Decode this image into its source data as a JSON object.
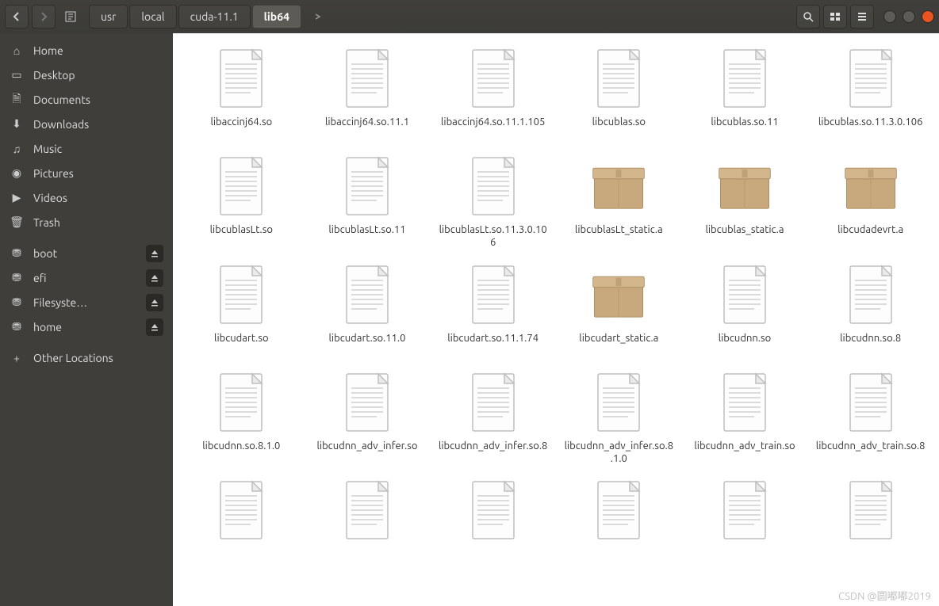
{
  "breadcrumb": [
    "usr",
    "local",
    "cuda-11.1",
    "lib64"
  ],
  "breadcrumb_active_index": 3,
  "sidebar": {
    "places": [
      {
        "icon": "home",
        "label": "Home"
      },
      {
        "icon": "desktop",
        "label": "Desktop"
      },
      {
        "icon": "document",
        "label": "Documents"
      },
      {
        "icon": "download",
        "label": "Downloads"
      },
      {
        "icon": "music",
        "label": "Music"
      },
      {
        "icon": "pictures",
        "label": "Pictures"
      },
      {
        "icon": "videos",
        "label": "Videos"
      },
      {
        "icon": "trash",
        "label": "Trash"
      }
    ],
    "mounts": [
      {
        "icon": "disk",
        "label": "boot",
        "eject": true
      },
      {
        "icon": "disk",
        "label": "efi",
        "eject": true
      },
      {
        "icon": "disk",
        "label": "Filesyste…",
        "eject": true
      },
      {
        "icon": "disk",
        "label": "home",
        "eject": true
      }
    ],
    "other": {
      "icon": "plus",
      "label": "Other Locations"
    }
  },
  "files": [
    {
      "name": "libaccinj64.so",
      "type": "text"
    },
    {
      "name": "libaccinj64.so.11.1",
      "type": "text"
    },
    {
      "name": "libaccinj64.so.11.1.105",
      "type": "text"
    },
    {
      "name": "libcublas.so",
      "type": "text"
    },
    {
      "name": "libcublas.so.11",
      "type": "text"
    },
    {
      "name": "libcublas.so.11.3.0.106",
      "type": "text"
    },
    {
      "name": "libcublasLt.so",
      "type": "text"
    },
    {
      "name": "libcublasLt.so.11",
      "type": "text"
    },
    {
      "name": "libcublasLt.so.11.3.0.106",
      "type": "text"
    },
    {
      "name": "libcublasLt_static.a",
      "type": "archive"
    },
    {
      "name": "libcublas_static.a",
      "type": "archive"
    },
    {
      "name": "libcudadevrt.a",
      "type": "archive"
    },
    {
      "name": "libcudart.so",
      "type": "text"
    },
    {
      "name": "libcudart.so.11.0",
      "type": "text"
    },
    {
      "name": "libcudart.so.11.1.74",
      "type": "text"
    },
    {
      "name": "libcudart_static.a",
      "type": "archive"
    },
    {
      "name": "libcudnn.so",
      "type": "text"
    },
    {
      "name": "libcudnn.so.8",
      "type": "text"
    },
    {
      "name": "libcudnn.so.8.1.0",
      "type": "text"
    },
    {
      "name": "libcudnn_adv_infer.so",
      "type": "text"
    },
    {
      "name": "libcudnn_adv_infer.so.8",
      "type": "text"
    },
    {
      "name": "libcudnn_adv_infer.so.8.1.0",
      "type": "text"
    },
    {
      "name": "libcudnn_adv_train.so",
      "type": "text"
    },
    {
      "name": "libcudnn_adv_train.so.8",
      "type": "text"
    },
    {
      "name": "",
      "type": "text"
    },
    {
      "name": "",
      "type": "text"
    },
    {
      "name": "",
      "type": "text"
    },
    {
      "name": "",
      "type": "text"
    },
    {
      "name": "",
      "type": "text"
    },
    {
      "name": "",
      "type": "text"
    }
  ],
  "watermark": "CSDN @圆嘟嘟2019"
}
